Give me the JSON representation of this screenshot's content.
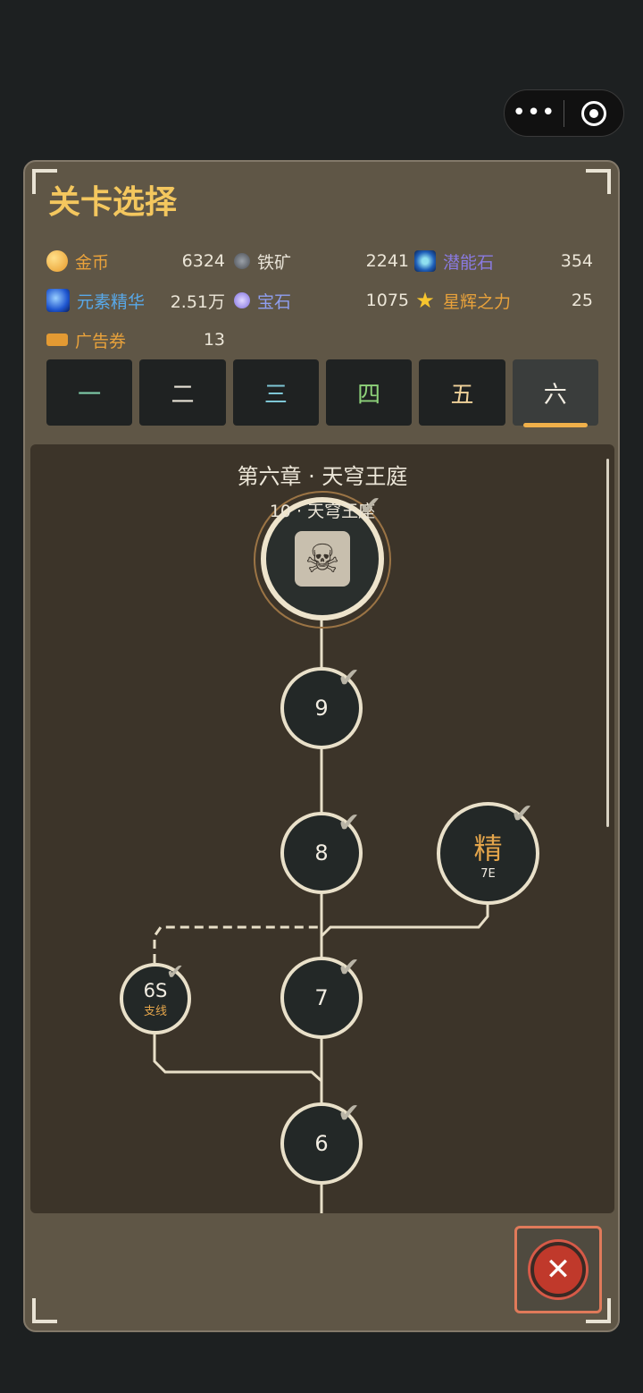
{
  "capsule": {
    "more_icon": "•••"
  },
  "title": "关卡选择",
  "resources": [
    {
      "name": "金币",
      "value": "6324",
      "color": "#e9a23b",
      "icon_color": "#f0a93a",
      "icon": "gold-coin-icon"
    },
    {
      "name": "铁矿",
      "value": "2241",
      "color": "#e7e2d6",
      "icon_color": "#666a70",
      "icon": "iron-ore-icon"
    },
    {
      "name": "潜能石",
      "value": "354",
      "color": "#8a7ae0",
      "icon_color": "#2b7fd0",
      "icon": "potential-stone-icon"
    },
    {
      "name": "元素精华",
      "value": "2.51万",
      "color": "#58a8e8",
      "icon_color": "#2a6de0",
      "icon": "element-essence-icon"
    },
    {
      "name": "宝石",
      "value": "1075",
      "color": "#8f9ef0",
      "icon_color": "#9a8ef0",
      "icon": "gem-icon"
    },
    {
      "name": "星辉之力",
      "value": "25",
      "color": "#e9a23b",
      "icon_color": "#f7c52e",
      "icon": "star-icon"
    },
    {
      "name": "广告券",
      "value": "13",
      "color": "#e9a23b",
      "icon_color": "#e39a33",
      "icon": "ticket-icon"
    }
  ],
  "tabs": [
    {
      "label": "一",
      "color": "#7ecba8"
    },
    {
      "label": "二",
      "color": "#e7e2d6"
    },
    {
      "label": "三",
      "color": "#7ec7d6"
    },
    {
      "label": "四",
      "color": "#8ed27a"
    },
    {
      "label": "五",
      "color": "#f0d29a"
    },
    {
      "label": "六",
      "color": "#f2ede2"
    }
  ],
  "active_tab": "六",
  "chapter_title": "第六章 · 天穹王庭",
  "boss_label": "10 · 天穹王座",
  "nodes": [
    {
      "id": "9",
      "label": "9"
    },
    {
      "id": "8",
      "label": "8"
    },
    {
      "id": "7E",
      "label": "精",
      "sub": "7E"
    },
    {
      "id": "7",
      "label": "7"
    },
    {
      "id": "6S",
      "label": "6S",
      "sub": "支线"
    },
    {
      "id": "6",
      "label": "6"
    }
  ],
  "check_glyph": "✔",
  "close_glyph": "✕"
}
